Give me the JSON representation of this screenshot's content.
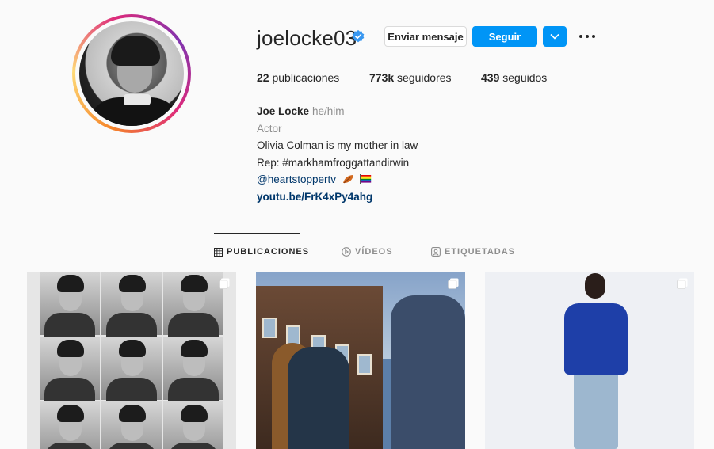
{
  "profile": {
    "username": "joelocke03",
    "verified": true,
    "buttons": {
      "message": "Enviar mensaje",
      "follow": "Seguir"
    },
    "stats": {
      "posts_value": "22",
      "posts_label": "publicaciones",
      "followers_value": "773k",
      "followers_label": "seguidores",
      "following_value": "439",
      "following_label": "seguidos"
    },
    "bio": {
      "name": "Joe Locke",
      "pronouns": "he/him",
      "category": "Actor",
      "line1": "Olivia Colman is my mother in law",
      "line2": "Rep: #markhamfroggattandirwin",
      "line3_mention": "@heartstoppertv",
      "link": "youtu.be/FrK4xPy4ahg"
    }
  },
  "tabs": [
    {
      "label": "PUBLICACIONES",
      "active": true
    },
    {
      "label": "VÍDEOS",
      "active": false
    },
    {
      "label": "ETIQUETADAS",
      "active": false
    }
  ],
  "colors": {
    "accent": "#0095f6",
    "link": "#00376b",
    "verified": "#3897f0"
  },
  "icons": {
    "verified": "verified-badge-icon",
    "dropdown": "chevron-down-icon",
    "more": "more-options-icon",
    "grid": "grid-icon",
    "video": "play-icon",
    "tagged": "tagged-icon",
    "multi": "carousel-icon"
  }
}
